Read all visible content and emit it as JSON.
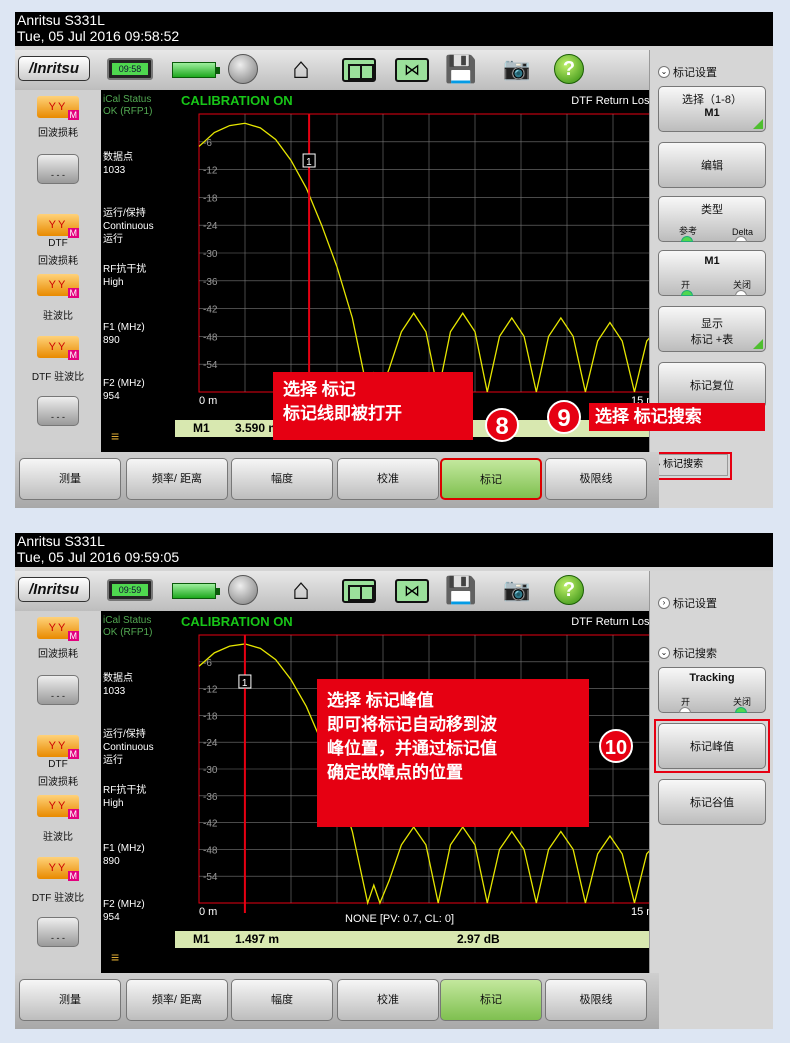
{
  "screen1": {
    "device": "Anritsu S331L",
    "datetime": "Tue, 05 Jul 2016 09:58:52",
    "clock": "09:58",
    "brand": "/Inritsu",
    "left": {
      "item1": "回波损耗",
      "btn1": "- - -",
      "item2_top": "DTF",
      "item2": "回波损耗",
      "item3": "驻波比",
      "item4": "DTF 驻波比",
      "btn2": "- - -"
    },
    "info": {
      "ical_label": "iCal Status",
      "ical_value": "OK (RFP1)",
      "points_label": "数据点",
      "points_value": "1033",
      "run_label": "运行/保持",
      "run_value": "Continuous",
      "run_value2": "运行",
      "rf_label": "RF抗干扰",
      "rf_value": "High",
      "f1_label": "F1 (MHz)",
      "f1_value": "890",
      "f2_label": "F2 (MHz)",
      "f2_value": "954"
    },
    "plot": {
      "cal": "CALIBRATION ON",
      "title": "DTF Return Loss",
      "x_start": "0 m",
      "x_end": "15 m",
      "marker_label": "1",
      "marker_row_name": "M1",
      "marker_row_dist": "3.590 m"
    },
    "right": {
      "header": "标记设置",
      "btn_select_title": "选择（1-8）",
      "btn_select_value": "M1",
      "btn_edit": "编辑",
      "btn_type_title": "类型",
      "btn_type_opt1": "参考",
      "btn_type_opt2": "Delta",
      "btn_m1_title": "M1",
      "btn_m1_on": "开",
      "btn_m1_off": "关闭",
      "btn_display_title": "显示",
      "btn_display_value": "标记 +表",
      "btn_reset": "标记复位",
      "search": "标记搜索"
    },
    "callouts": {
      "box8_line1": "选择  标记",
      "box8_line2": "标记线即被打开",
      "num8": "8",
      "num9": "9",
      "box9": "选择  标记搜索"
    }
  },
  "screen2": {
    "device": "Anritsu S331L",
    "datetime": "Tue, 05 Jul 2016 09:59:05",
    "clock": "09:59",
    "plot": {
      "cal": "CALIBRATION ON",
      "title": "DTF Return Loss",
      "x_start": "0 m",
      "x_end": "15 m",
      "status": "NONE [PV: 0.7,  CL: 0]",
      "marker_label": "1",
      "marker_row_name": "M1",
      "marker_row_dist": "1.497 m",
      "marker_row_val": "2.97 dB"
    },
    "right": {
      "header1": "标记设置",
      "header2": "标记搜索",
      "tracking_title": "Tracking",
      "tracking_on": "开",
      "tracking_off": "关闭",
      "btn_peak": "标记峰值",
      "btn_valley": "标记谷值"
    },
    "callouts": {
      "line1": "选择  标记峰值",
      "line2": "即可将标记自动移到波",
      "line3": "峰位置，并通过标记值",
      "line4": "确定故障点的位置",
      "num10": "10"
    }
  },
  "bottom_menu": [
    "测量",
    "频率/ 距离",
    "幅度",
    "校准",
    "标记",
    "极限线"
  ],
  "y_ticks": [
    "-6",
    "-12",
    "-18",
    "-24",
    "-30",
    "-36",
    "-42",
    "-48",
    "-54"
  ],
  "chart_data": [
    {
      "type": "line",
      "title": "DTF Return Loss",
      "xlabel": "",
      "ylabel": "",
      "xlim": [
        0,
        15
      ],
      "ylim": [
        -60,
        0
      ],
      "y_ticks": [
        -6,
        -12,
        -18,
        -24,
        -30,
        -36,
        -42,
        -48,
        -54
      ],
      "grid": true,
      "series": [
        {
          "x": [
            0,
            0.5,
            1.0,
            1.5,
            2.0,
            2.5,
            3.0,
            3.5,
            4.0,
            4.5,
            5.0,
            5.25,
            5.5,
            5.7,
            5.9,
            6.2,
            6.6,
            7.0,
            7.4,
            7.8,
            8.2,
            8.6,
            9.0,
            9.4,
            9.8,
            10.2,
            10.6,
            11.0,
            11.4,
            11.8,
            12.2,
            12.6,
            13.0,
            13.4,
            13.8,
            14.2,
            14.6,
            15.0
          ],
          "y": [
            -7,
            -4,
            -2.5,
            -2,
            -3,
            -5.5,
            -10,
            -16,
            -24,
            -33,
            -44,
            -52,
            -60,
            -56,
            -60,
            -55,
            -47,
            -43,
            -47,
            -60,
            -47,
            -43,
            -47,
            -60,
            -48,
            -44,
            -48,
            -60,
            -48,
            -44,
            -48,
            -60,
            -49,
            -45,
            -49,
            -60,
            -49,
            -46
          ]
        }
      ],
      "markers": [
        {
          "name": "M1",
          "x": 3.59,
          "label": "3.590 m"
        }
      ]
    },
    {
      "type": "line",
      "title": "DTF Return Loss",
      "xlabel": "",
      "ylabel": "",
      "xlim": [
        0,
        15
      ],
      "ylim": [
        -60,
        0
      ],
      "y_ticks": [
        -6,
        -12,
        -18,
        -24,
        -30,
        -36,
        -42,
        -48,
        -54
      ],
      "grid": true,
      "series": [
        {
          "x": [
            0,
            0.5,
            1.0,
            1.5,
            2.0,
            2.5,
            3.0,
            3.5,
            4.0,
            4.5,
            5.0,
            5.25,
            5.5,
            5.7,
            5.9,
            6.2,
            6.6,
            7.0,
            7.4,
            7.8,
            8.2,
            8.6,
            9.0,
            9.4,
            9.8,
            10.2,
            10.6,
            11.0,
            11.4,
            11.8,
            12.2,
            12.6,
            13.0,
            13.4,
            13.8,
            14.2,
            14.6,
            15.0
          ],
          "y": [
            -7,
            -4,
            -2.5,
            -2,
            -3,
            -5.5,
            -10,
            -16,
            -24,
            -33,
            -44,
            -52,
            -60,
            -56,
            -60,
            -55,
            -47,
            -43,
            -47,
            -60,
            -47,
            -43,
            -47,
            -60,
            -48,
            -44,
            -48,
            -60,
            -48,
            -44,
            -48,
            -60,
            -49,
            -45,
            -49,
            -60,
            -49,
            -46
          ]
        }
      ],
      "markers": [
        {
          "name": "M1",
          "x": 1.497,
          "label": "1.497 m",
          "value": "2.97 dB"
        }
      ]
    }
  ],
  "colors": {
    "trace": "#e6e600",
    "marker_line": "#e60012",
    "callout": "#e60012",
    "cal_text": "#18c618",
    "active_button": "#9ed46f"
  }
}
